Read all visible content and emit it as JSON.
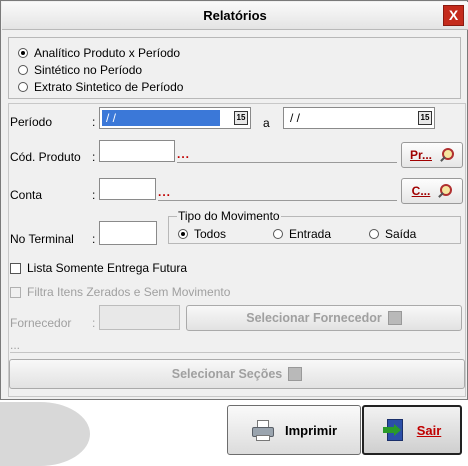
{
  "window": {
    "title": "Relatórios",
    "close_label": "X"
  },
  "report_type": {
    "options": [
      {
        "label": "Analítico Produto x Período",
        "selected": true
      },
      {
        "label": "Sintético no Período",
        "selected": false
      },
      {
        "label": "Extrato Sintetico de Período",
        "selected": false
      }
    ]
  },
  "periodo": {
    "label": "Período",
    "colon": ":",
    "start_value": " / / ",
    "separator": "a",
    "end_value": " / / "
  },
  "cod_produto": {
    "label": "Cód. Produto",
    "colon": ":",
    "dots": "...",
    "button_label": "Pr..."
  },
  "conta": {
    "label": "Conta",
    "colon": ":",
    "dots": "...",
    "button_label": "C..."
  },
  "terminal": {
    "label": "No Terminal",
    "colon": ":"
  },
  "tipo_movimento": {
    "label": "Tipo do Movimento",
    "options": [
      {
        "label": "Todos",
        "selected": true
      },
      {
        "label": "Entrada",
        "selected": false
      },
      {
        "label": "Saída",
        "selected": false
      }
    ]
  },
  "checks": {
    "entrega_futura": "Lista Somente Entrega Futura",
    "itens_zerados": "Filtra Itens Zerados e Sem Movimento"
  },
  "fornecedor": {
    "label": "Fornecedor",
    "colon": ":",
    "button_label": "Selecionar Fornecedor",
    "dots": "..."
  },
  "secoes": {
    "button_label": "Selecionar Seções"
  },
  "footer": {
    "print_label": "Imprimir",
    "exit_label": "Sair"
  }
}
